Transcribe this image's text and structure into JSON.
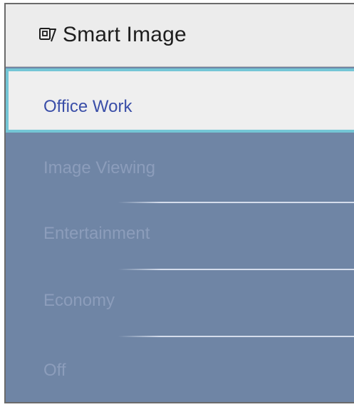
{
  "header": {
    "icon": "smart-image-icon",
    "title": "Smart Image"
  },
  "menu": {
    "selected_index": 0,
    "items": [
      {
        "label": "Office Work"
      },
      {
        "label": "Image Viewing"
      },
      {
        "label": "Entertainment"
      },
      {
        "label": "Economy"
      },
      {
        "label": "Off"
      }
    ]
  },
  "colors": {
    "panel_bg": "#6f85a5",
    "header_bg": "#ececec",
    "selected_bg": "#efefef",
    "selected_border": "#74c6d6",
    "selected_text": "#3a4ea8",
    "item_text": "#8c9dbb"
  }
}
